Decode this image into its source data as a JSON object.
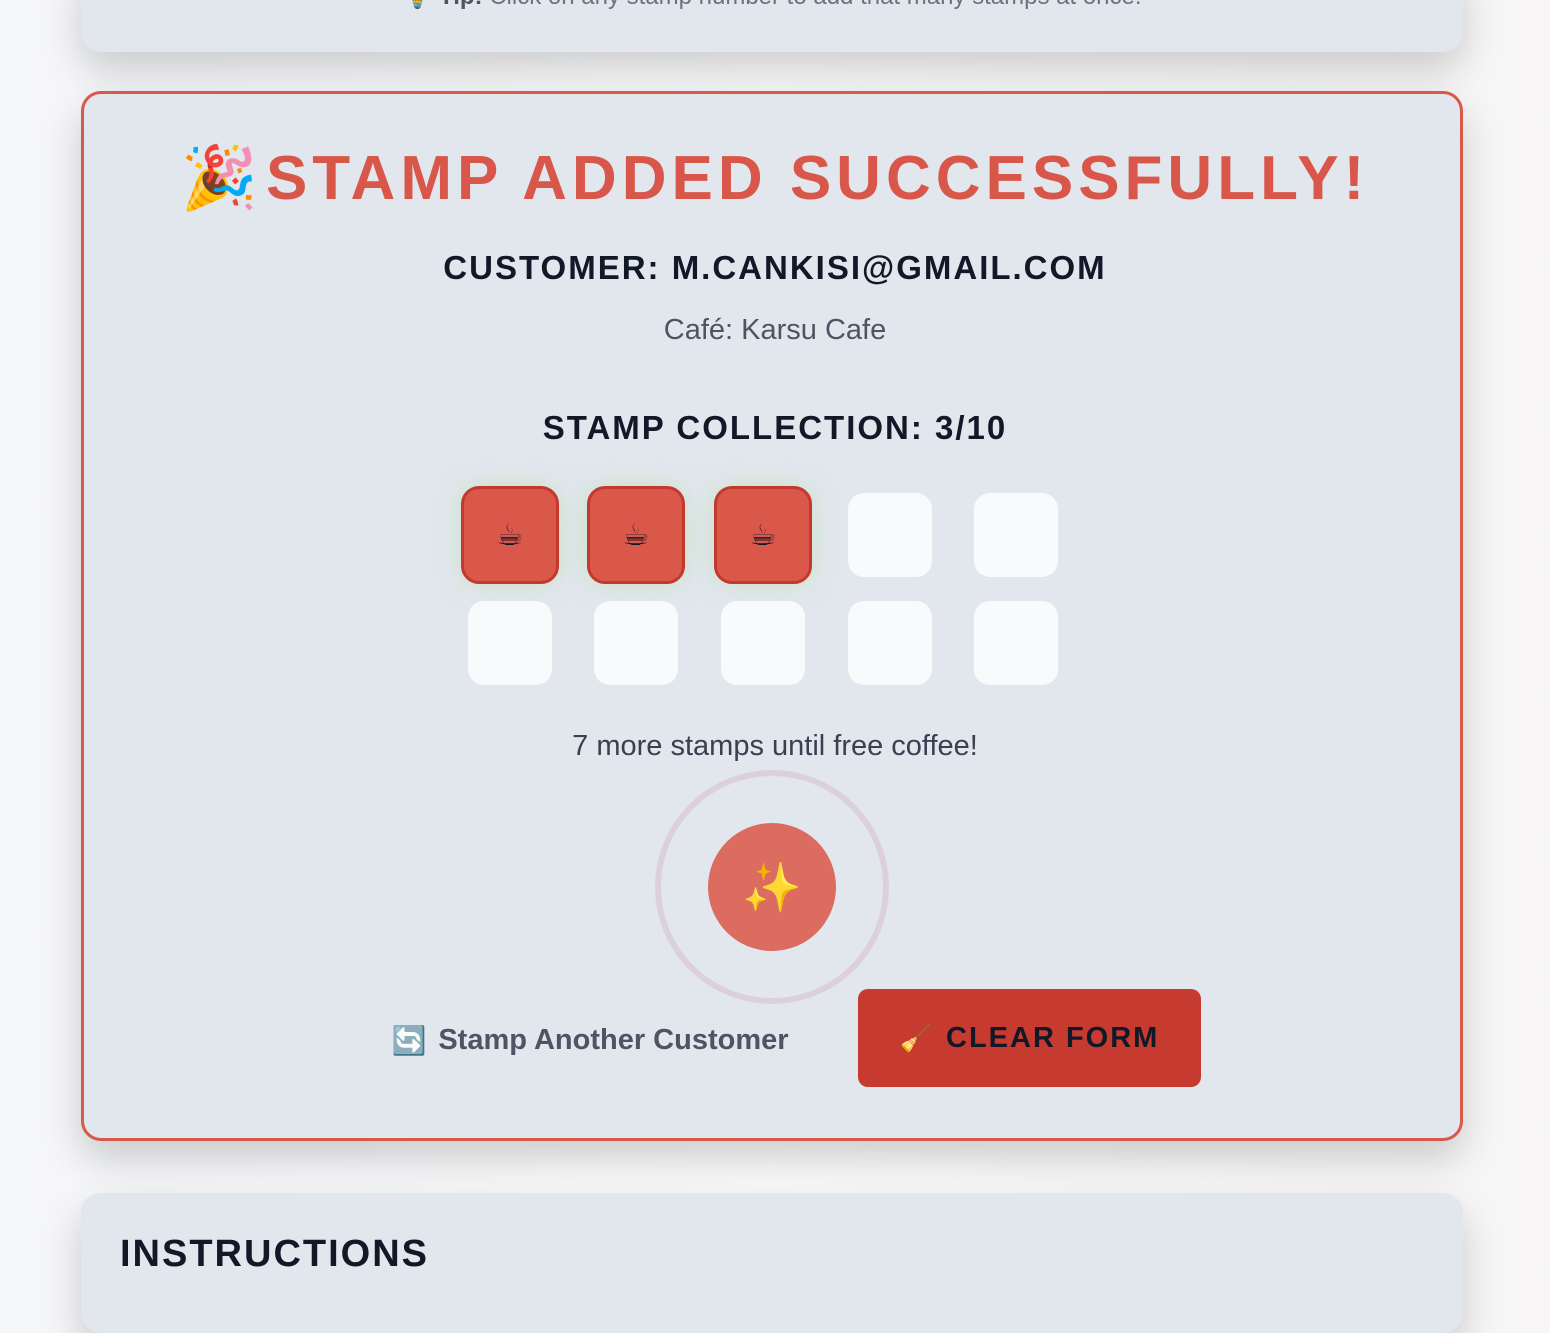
{
  "tip": {
    "icon": "💡",
    "label": "Tip:",
    "text": "Click on any stamp number to add that many stamps at once."
  },
  "success": {
    "icon": "🎉",
    "title": "STAMP ADDED SUCCESSFULLY!",
    "customer": "CUSTOMER: M.CANKISI@GMAIL.COM",
    "cafe": "Café: Karsu Cafe",
    "collection_label": "STAMP COLLECTION: 3/10",
    "stamp_icon": "☕",
    "stamps_collected": 3,
    "stamps_total": 10,
    "remaining_text": "7 more stamps until free coffee!",
    "sparkle_icon": "✨"
  },
  "actions": {
    "another_icon": "🔄",
    "another_label": "Stamp Another Customer",
    "clear_icon": "🧹",
    "clear_label": "CLEAR FORM"
  },
  "instructions": {
    "title": "INSTRUCTIONS"
  },
  "colors": {
    "accent": "#d9574a",
    "button": "#c63a2f",
    "card": "#e2e7ee",
    "empty_stamp": "#f8fafc"
  }
}
